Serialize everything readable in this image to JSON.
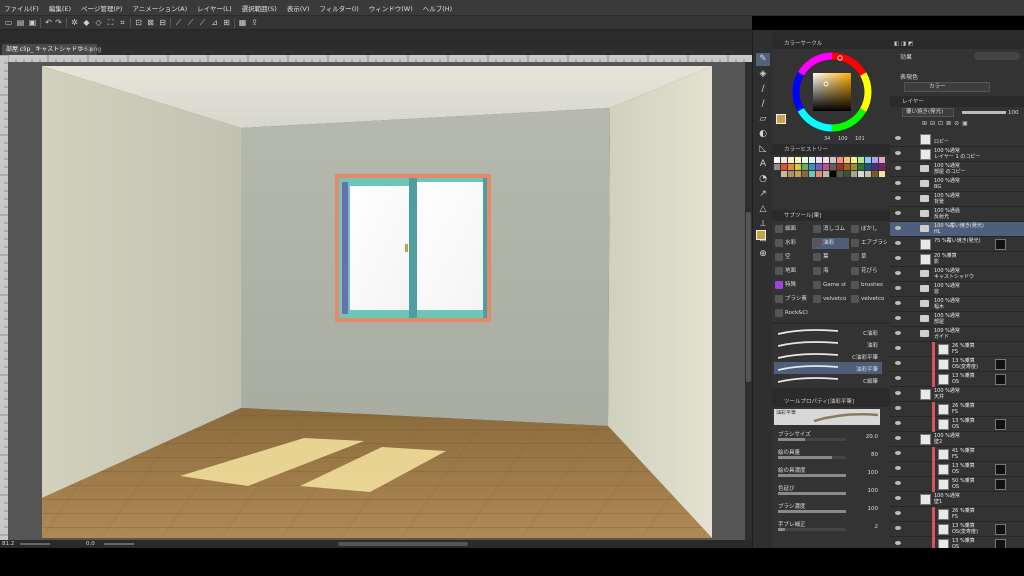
{
  "menubar": {
    "items": [
      "ファイル(F)",
      "編集(E)",
      "ページ管理(P)",
      "アニメーション(A)",
      "レイヤー(L)",
      "選択範囲(S)",
      "表示(V)",
      "フィルター(I)",
      "ウィンドウ(W)",
      "ヘルプ(H)"
    ]
  },
  "tabs": {
    "active": "部屋.clip_ キャストシャドウ",
    "second": "2-6.png"
  },
  "status": {
    "zoom": "81.2",
    "angle": "0.0"
  },
  "panels": {
    "color_circle": "カラーサークル",
    "color_values": {
      "h": "34",
      "s": "100",
      "v": "101"
    },
    "color_history": "カラーヒストリー",
    "sub_tool": "サブツール[筆]",
    "tool_property": "ツールプロパティ[油彩平筆]",
    "effects": "効果",
    "expression_color": "表現色",
    "expression_value": "カラー",
    "layer_tab": "レイヤー",
    "blend_mode": "覆い焼き(発光)",
    "opacity": "100"
  },
  "sub_tool_groups": [
    "細面",
    "消しゴム",
    "ぼかし",
    "水彩",
    "油彩",
    "エアブラシ",
    "空",
    "葉",
    "草",
    "地面",
    "海",
    "花びら",
    "特殊",
    "Game st",
    "brushes",
    "ブラシ素",
    "velvetco",
    "velvetco",
    "Rock&Cl"
  ],
  "brushes": [
    "C油彩",
    "油彩",
    "C油彩平筆",
    "油彩平筆",
    "C細筆"
  ],
  "brush_preview_label": "油彩平筆",
  "tool_props": [
    {
      "label": "ブラシサイズ",
      "value": "20.0",
      "fill": 0.4
    },
    {
      "label": "絵の具量",
      "value": "80",
      "fill": 0.8
    },
    {
      "label": "絵の具濃度",
      "value": "100",
      "fill": 1.0
    },
    {
      "label": "色延び",
      "value": "100",
      "fill": 1.0
    },
    {
      "label": "ブラシ濃度",
      "value": "100",
      "fill": 1.0
    },
    {
      "label": "手ブレ補正",
      "value": "2",
      "fill": 0.1
    }
  ],
  "layers": [
    {
      "mode": "",
      "name": "ロピー",
      "type": "layer"
    },
    {
      "mode": "100 %通常",
      "name": "レイヤー 1 のコピー",
      "type": "layer"
    },
    {
      "mode": "100 %通常",
      "name": "部屋 のコピー",
      "type": "folder"
    },
    {
      "mode": "100 %通常",
      "name": "BG",
      "type": "folder"
    },
    {
      "mode": "100 %通常",
      "name": "背景",
      "type": "folder"
    },
    {
      "mode": "100 %通過",
      "name": "反射光",
      "type": "folder"
    },
    {
      "mode": "100 %覆い焼き(発光)",
      "name": "HL",
      "type": "folder",
      "selected": true
    },
    {
      "mode": "75 %覆い焼き(発光)",
      "name": "",
      "type": "layer",
      "mask": true
    },
    {
      "mode": "20 %乗算",
      "name": "影",
      "type": "layer"
    },
    {
      "mode": "100 %通常",
      "name": "キャストシャドウ",
      "type": "folder"
    },
    {
      "mode": "100 %通常",
      "name": "窓",
      "type": "folder"
    },
    {
      "mode": "100 %通常",
      "name": "幅木",
      "type": "folder"
    },
    {
      "mode": "100 %通常",
      "name": "部屋",
      "type": "folder"
    },
    {
      "mode": "100 %通常",
      "name": "ガイド",
      "type": "folder"
    },
    {
      "mode": "26 %乗算",
      "name": "FS",
      "type": "layer",
      "clip": true
    },
    {
      "mode": "13 %乗算",
      "name": "OS(変寿度)",
      "type": "layer",
      "clip": true,
      "mask": true
    },
    {
      "mode": "13 %乗算",
      "name": "OS",
      "type": "layer",
      "clip": true,
      "mask": true
    },
    {
      "mode": "100 %通常",
      "name": "天井",
      "type": "layer"
    },
    {
      "mode": "26 %乗算",
      "name": "FS",
      "type": "layer",
      "clip": true
    },
    {
      "mode": "13 %乗算",
      "name": "OS",
      "type": "layer",
      "clip": true,
      "mask": true
    },
    {
      "mode": "100 %通常",
      "name": "壁2",
      "type": "layer"
    },
    {
      "mode": "41 %乗算",
      "name": "FS",
      "type": "layer",
      "clip": true
    },
    {
      "mode": "13 %乗算",
      "name": "OS",
      "type": "layer",
      "clip": true,
      "mask": true
    },
    {
      "mode": "50 %乗算",
      "name": "OS",
      "type": "layer",
      "clip": true,
      "mask": true
    },
    {
      "mode": "100 %通常",
      "name": "壁1",
      "type": "layer"
    },
    {
      "mode": "26 %乗算",
      "name": "FS",
      "type": "layer",
      "clip": true
    },
    {
      "mode": "13 %乗算",
      "name": "OS(変寿度)",
      "type": "layer",
      "clip": true,
      "mask": true
    },
    {
      "mode": "13 %乗算",
      "name": "OS",
      "type": "layer",
      "clip": true,
      "mask": true
    }
  ],
  "colors": {
    "main_color": "#c8a24a",
    "window_frame": "#e48a6a",
    "window_sash": "#6fc6b8",
    "selected_layer": "#4d5f7a"
  }
}
